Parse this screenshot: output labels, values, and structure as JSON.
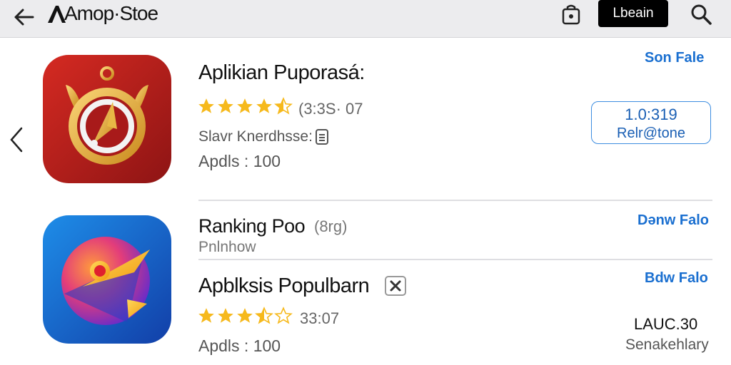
{
  "header": {
    "title": "Amop·Stoe",
    "login_label": "Lbeain"
  },
  "apps": [
    {
      "title": "Aplikian Puporasá:",
      "rating_text": "(3:3S· 07",
      "stars": 4.5,
      "developer": "Slavr Knerdhsse:",
      "apps_count": "Apdls : 100",
      "action_link": "Son Fale",
      "price_line1": "1.0:319",
      "price_line2": "Relr@tone"
    }
  ],
  "ranking": {
    "title": "Ranking Poo",
    "badge": "(8rg)",
    "subtitle": "Pnlnhow",
    "action_link": "Dәnw Falo"
  },
  "popular": {
    "title": "Apblksis Populbarn",
    "rating_text": "33:07",
    "stars": 3.5,
    "apps_count": "Apdls : 100",
    "action_link": "Bdw Falo",
    "price": "LAUC.30",
    "price_sub": "Senakehlary"
  },
  "colors": {
    "accent": "#1a6fd0",
    "star": "#f6b91c",
    "topbar": "#ececee"
  },
  "icons": [
    "back-arrow-icon",
    "logo-icon",
    "shopping-bag-icon",
    "search-icon",
    "chevron-left-icon",
    "info-icon",
    "close-icon"
  ]
}
